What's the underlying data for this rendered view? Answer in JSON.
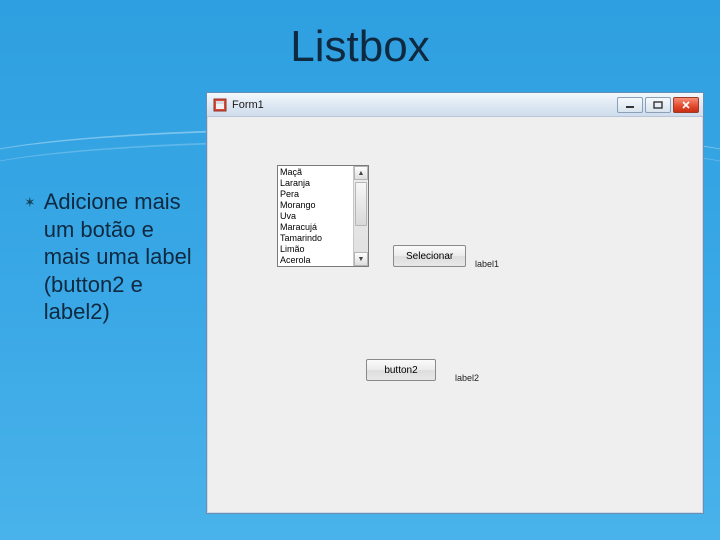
{
  "slide": {
    "title": "Listbox",
    "bullet": "Adicione mais um botão e mais uma label (button2 e label2)"
  },
  "window": {
    "title": "Form1",
    "listbox": {
      "items": [
        "Maçã",
        "Laranja",
        "Pera",
        "Morango",
        "Uva",
        "Maracujá",
        "Tamarindo",
        "Limão",
        "Acerola"
      ]
    },
    "button1": {
      "label": "Selecionar"
    },
    "button2": {
      "label": "button2"
    },
    "label1": {
      "text": "label1"
    },
    "label2": {
      "text": "label2"
    }
  }
}
